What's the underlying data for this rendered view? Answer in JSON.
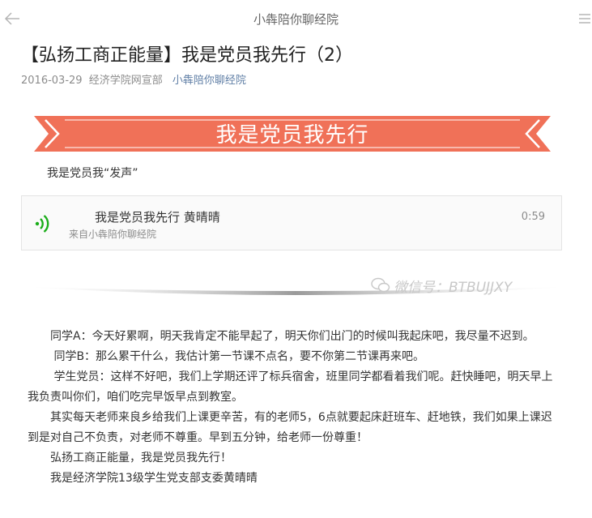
{
  "topbar": {
    "title": "小犇陪你聊经院"
  },
  "article": {
    "title": "【弘扬工商正能量】我是党员我先行（2）",
    "date": "2016-03-29",
    "author": "经济学院网宣部",
    "account": "小犇陪你聊经院"
  },
  "banner": {
    "text": "我是党员我先行",
    "color": "#f07158"
  },
  "intro": "我是党员我“发声”",
  "audio": {
    "title": "我是党员我先行 黄晴晴",
    "source": "来自小犇陪你聊经院",
    "duration": "0:59",
    "icon": "audio-wave-icon",
    "accent": "#1aad19"
  },
  "watermark": {
    "text": "微信号：BTBUJJXY",
    "icon": "wechat-icon"
  },
  "paragraphs": [
    "　　同学A：今天好累啊，明天我肯定不能早起了，明天你们出门的时候叫我起床吧，我尽量不迟到。",
    "　　 同学B：那么累干什么，我估计第一节课不点名，要不你第二节课再来吧。",
    "　　 学生党员：这样不好吧，我们上学期还评了标兵宿舍，班里同学都看着我们呢。赶快睡吧，明天早上我负责叫你们，咱们吃完早饭早点到教室。",
    "　　其实每天老师来良乡给我们上课更辛苦，有的老师5，6点就要起床赶班车、赶地铁，我们如果上课迟到是对自己不负责，对老师不尊重。早到五分钟，给老师一份尊重！",
    "　　弘扬工商正能量，我是党员我先行！",
    "　　我是经济学院13级学生党支部支委黄晴晴"
  ]
}
